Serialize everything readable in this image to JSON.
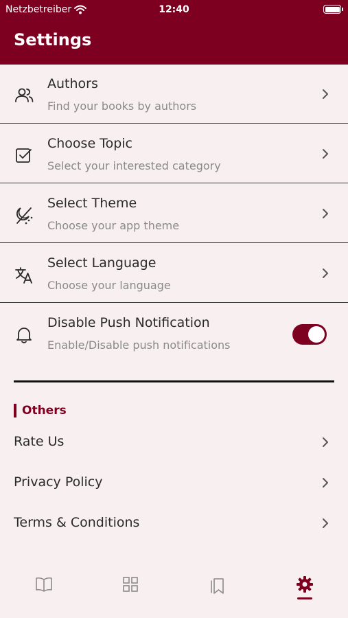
{
  "status_bar": {
    "carrier": "Netzbetreiber",
    "time": "12:40"
  },
  "header": {
    "title": "Settings"
  },
  "settings_items": [
    {
      "title": "Authors",
      "subtitle": "Find your books by authors",
      "icon": "users-icon"
    },
    {
      "title": "Choose Topic",
      "subtitle": "Select your interested category",
      "icon": "checkbox-icon"
    },
    {
      "title": "Select Theme",
      "subtitle": "Choose your app theme",
      "icon": "theme-icon"
    },
    {
      "title": "Select Language",
      "subtitle": "Choose your language",
      "icon": "translate-icon"
    },
    {
      "title": "Disable Push Notification",
      "subtitle": "Enable/Disable push notifications",
      "icon": "bell-icon",
      "toggle_on": true
    }
  ],
  "others": {
    "section_label": "Others",
    "items": [
      {
        "label": "Rate Us"
      },
      {
        "label": "Privacy Policy"
      },
      {
        "label": "Terms & Conditions"
      }
    ]
  },
  "tab_bar": {
    "tabs": [
      {
        "icon": "book-icon",
        "active": false
      },
      {
        "icon": "grid-icon",
        "active": false
      },
      {
        "icon": "bookmark-icon",
        "active": false
      },
      {
        "icon": "gear-icon",
        "active": true
      }
    ]
  },
  "colors": {
    "accent": "#7d0020",
    "background": "#f7eff0",
    "text": "#2a2a2a",
    "subtext": "#8a8a8a"
  }
}
